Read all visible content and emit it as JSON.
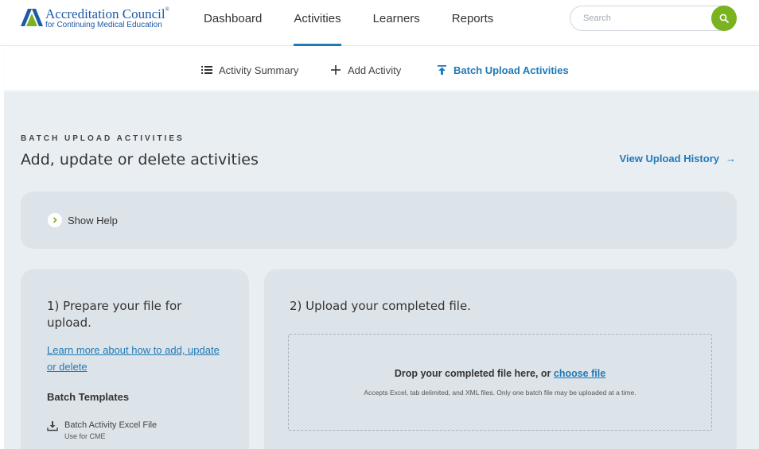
{
  "header": {
    "logo": {
      "line1": "Accreditation Council",
      "registered": "®",
      "line2": "for Continuing Medical Education"
    },
    "nav": [
      {
        "label": "Dashboard",
        "active": false
      },
      {
        "label": "Activities",
        "active": true
      },
      {
        "label": "Learners",
        "active": false
      },
      {
        "label": "Reports",
        "active": false
      }
    ],
    "search": {
      "placeholder": "Search",
      "icon": "search-icon"
    }
  },
  "subnav": {
    "items": [
      {
        "label": "Activity Summary",
        "icon": "list-icon",
        "active": false
      },
      {
        "label": "Add Activity",
        "icon": "plus-icon",
        "active": false
      },
      {
        "label": "Batch Upload Activities",
        "icon": "upload-icon",
        "active": true
      }
    ]
  },
  "page": {
    "eyebrow": "BATCH UPLOAD ACTIVITIES",
    "title": "Add, update or delete activities",
    "history_link": "View Upload History",
    "history_arrow": "→"
  },
  "help": {
    "toggle_label": "Show Help",
    "icon": "chevron-right-icon"
  },
  "step1": {
    "title": "1) Prepare your file for upload.",
    "learn_link": "Learn more about how to add, update or delete",
    "templates_heading": "Batch Templates",
    "templates": [
      {
        "name": "Batch Activity Excel File",
        "note": "Use for CME",
        "icon": "download-icon"
      }
    ]
  },
  "step2": {
    "title": "2) Upload your completed file.",
    "drop_text": "Drop your completed file here, or",
    "choose_link": "choose file",
    "accepts_text": "Accepts Excel, tab delimited, and XML files. Only one batch file may be uploaded at a time."
  },
  "colors": {
    "accent_blue": "#1f7ab8",
    "brand_green": "#7ab31f",
    "content_bg": "#e9eef2",
    "card_bg": "#dde4e9"
  }
}
